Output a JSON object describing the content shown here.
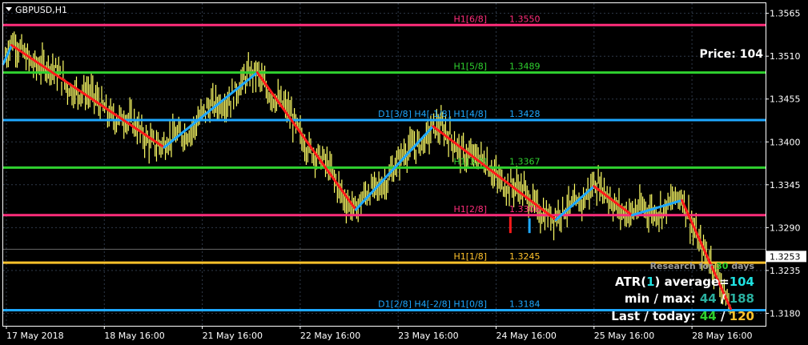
{
  "chart_data": {
    "type": "line",
    "symbol_timeframe": "GBPUSD,H1",
    "ylim": [
      1.3164,
      1.3578
    ],
    "y_ticks": [
      "1.3565",
      "1.3510",
      "1.3455",
      "1.3400",
      "1.3345",
      "1.3290",
      "1.3235",
      "1.3180"
    ],
    "x_ticks": [
      "17 May 2018",
      "18 May 16:00",
      "21 May 16:00",
      "22 May 16:00",
      "23 May 16:00",
      "24 May 16:00",
      "25 May 16:00",
      "28 May 16:00"
    ],
    "current_price": {
      "label": "1.3253",
      "value": 1.3253
    },
    "levels": [
      {
        "label": "H1[6/8]",
        "price_label": "1.3550",
        "value": 1.355,
        "color": "#ff2d7a"
      },
      {
        "label": "H1[5/8]",
        "price_label": "1.3489",
        "value": 1.3489,
        "color": "#2fd12f"
      },
      {
        "label": "D1[3/8] H4[-1/8] H1[4/8]",
        "price_label": "1.3428",
        "value": 1.3428,
        "color": "#1ea8ff"
      },
      {
        "label": "H1[3/8]",
        "price_label": "1.3367",
        "value": 1.3367,
        "color": "#2fd12f"
      },
      {
        "label": "H1[2/8]",
        "price_label": "1.3306",
        "value": 1.3306,
        "color": "#ff2d7a"
      },
      {
        "label": "H1[1/8]",
        "price_label": "1.3245",
        "value": 1.3245,
        "color": "#ffc22b"
      },
      {
        "label": "D1[2/8] H4[-2/8] H1[0/8]",
        "price_label": "1.3184",
        "value": 1.3184,
        "color": "#1ea8ff"
      }
    ],
    "zigzag": [
      {
        "t": 0.0,
        "v": 1.35
      },
      {
        "t": 0.8,
        "v": 1.3524
      },
      {
        "t": 15.2,
        "v": 1.3393,
        "c": "#ff1a1a"
      },
      {
        "t": 24.0,
        "v": 1.3489,
        "c": "#1ea8ff"
      },
      {
        "t": 33.3,
        "v": 1.3313,
        "c": "#ff1a1a"
      },
      {
        "t": 40.6,
        "v": 1.342,
        "c": "#1ea8ff"
      },
      {
        "t": 52.2,
        "v": 1.33,
        "c": "#ff1a1a"
      },
      {
        "t": 55.8,
        "v": 1.3343,
        "c": "#1ea8ff"
      },
      {
        "t": 59.4,
        "v": 1.3306,
        "c": "#ff1a1a"
      },
      {
        "t": 64.1,
        "v": 1.3325,
        "c": "#1ea8ff"
      },
      {
        "t": 68.7,
        "v": 1.3186,
        "c": "#ff1a1a"
      }
    ],
    "markers": [
      {
        "t": 47.9,
        "v_top": 1.3304,
        "v_bottom": 1.3283,
        "color": "#ff1a1a"
      },
      {
        "t": 49.7,
        "v_top": 1.3302,
        "v_bottom": 1.3283,
        "color": "#1ea8ff"
      }
    ]
  },
  "info": {
    "price_label": "Price:",
    "price_value": "104",
    "research_prefix": "Research for",
    "research_days": "30",
    "research_suffix": "days",
    "atr_prefix": "ATR(",
    "atr_period": "1",
    "atr_mid": ") average=",
    "atr_value": "104",
    "minmax_label": "min / max:",
    "min_value": "44",
    "minmax_sep": "/",
    "max_value": "188",
    "last_label": "Last / today:",
    "last_value": "44",
    "today_sep": "/",
    "today_value": "120"
  },
  "colors": {
    "background": "#000000",
    "grid": "#2f3a4a",
    "candles": "#ffff66",
    "text": "#ffffff",
    "cyan": "#1ee0e0",
    "teal": "#2ab0a0",
    "green": "#2fd12f",
    "gold": "#ffc22b",
    "gray": "#9a9a9a"
  }
}
